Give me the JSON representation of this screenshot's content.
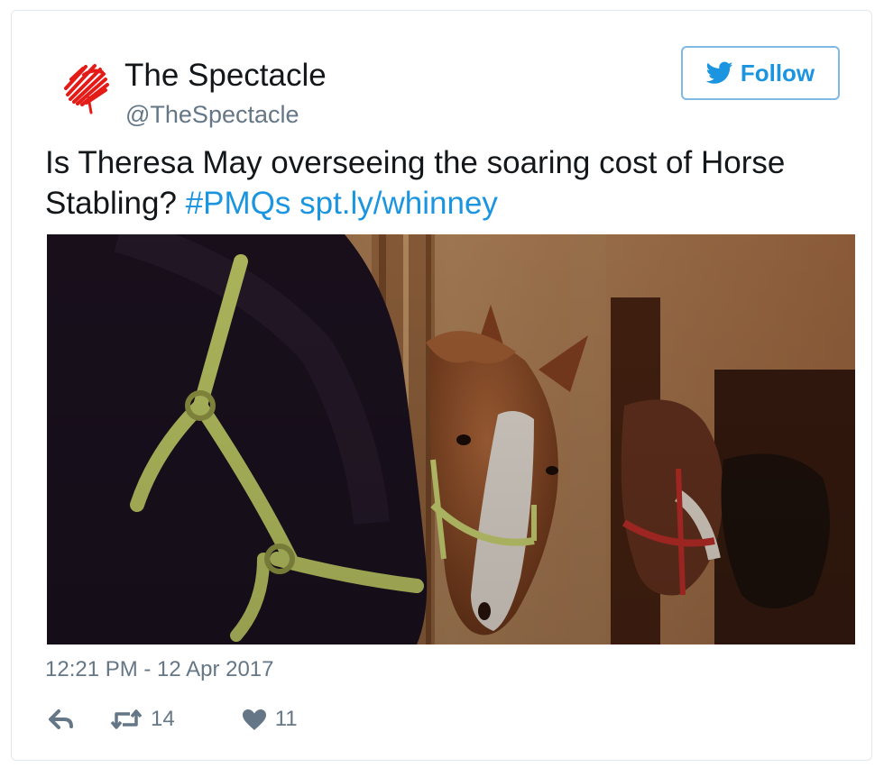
{
  "tweet": {
    "author": {
      "display_name": "The Spectacle",
      "handle": "@TheSpectacle",
      "avatar_icon": "red-scribble-logo"
    },
    "follow_button": {
      "label": "Follow",
      "icon": "twitter-bird-icon",
      "color": "#1b95e0"
    },
    "text": {
      "body": "Is Theresa May overseeing the soaring cost of Horse Stabling? ",
      "hashtag": "#PMQs",
      "link": "spt.ly/whinney"
    },
    "media": {
      "type": "photo"
    },
    "timestamp": "12:21 PM - 12 Apr 2017",
    "actions": {
      "reply_icon": "reply-icon",
      "retweet_icon": "retweet-icon",
      "retweet_count": "14",
      "like_icon": "heart-icon",
      "like_count": "11"
    }
  }
}
